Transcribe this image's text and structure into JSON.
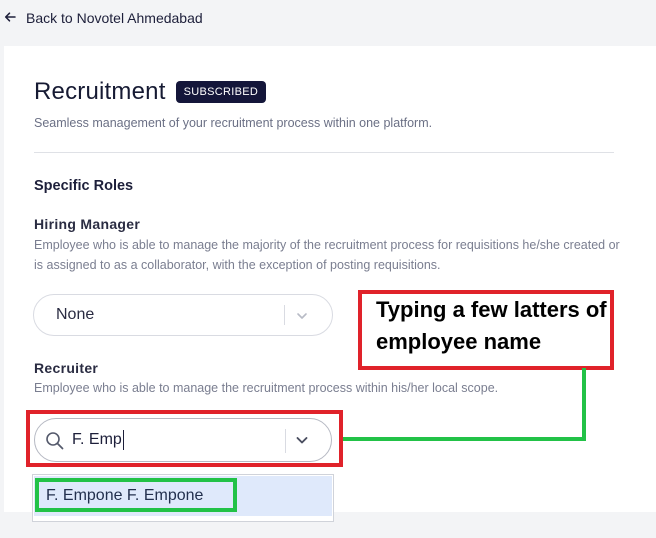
{
  "back": {
    "label": "Back to Novotel Ahmedabad"
  },
  "header": {
    "title": "Recruitment",
    "badge": "SUBSCRIBED",
    "subtitle": "Seamless management of your recruitment process within one platform."
  },
  "section": {
    "title": "Specific Roles"
  },
  "hiring_manager": {
    "label": "Hiring Manager",
    "description": "Employee who is able to manage the majority of the recruitment process for requisitions he/she created or is assigned to as a collaborator, with the exception of posting requisitions.",
    "selected_value": "None"
  },
  "recruiter": {
    "label": "Recruiter",
    "description": "Employee who is able to manage the recruitment process within his/her local scope.",
    "search_value": "F. Emp",
    "options": [
      "F. Empone F. Empone"
    ]
  },
  "annotation": {
    "text": "Typing a few latters of employee name"
  },
  "colors": {
    "annotation_red": "#e0222a",
    "annotation_green": "#22c247",
    "badge_bg": "#14163a",
    "option_highlight": "#dfe9fb"
  },
  "icons": [
    "arrow-left-icon",
    "chevron-down-icon",
    "search-icon"
  ]
}
